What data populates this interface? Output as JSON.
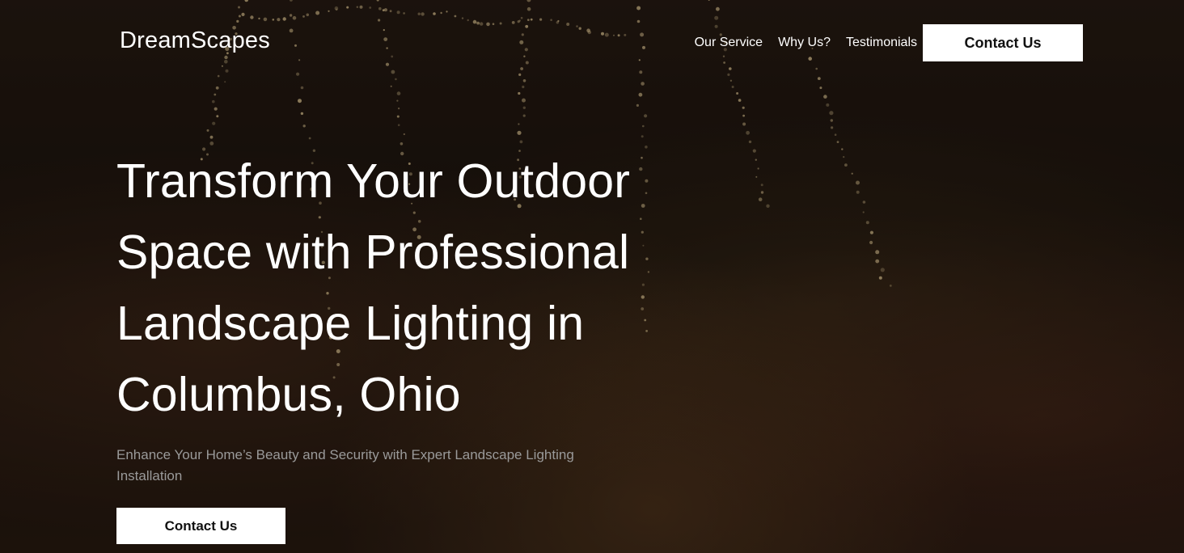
{
  "header": {
    "logo": "DreamScapes",
    "nav": [
      "Our Service",
      "Why Us?",
      "Testimonials"
    ],
    "cta_label": "Contact Us"
  },
  "hero": {
    "headline": "Transform Your Outdoor Space with Professional Landscape Lighting in Columbus, Ohio",
    "subheadline": "Enhance Your Home’s Beauty and Security with Expert Landscape Lighting Installation",
    "cta_label": "Contact Us"
  },
  "colors": {
    "overlay": "#000000",
    "button_bg": "#ffffff",
    "button_text": "#111111",
    "text": "#ffffff",
    "subtext": "#9a9a9a"
  }
}
